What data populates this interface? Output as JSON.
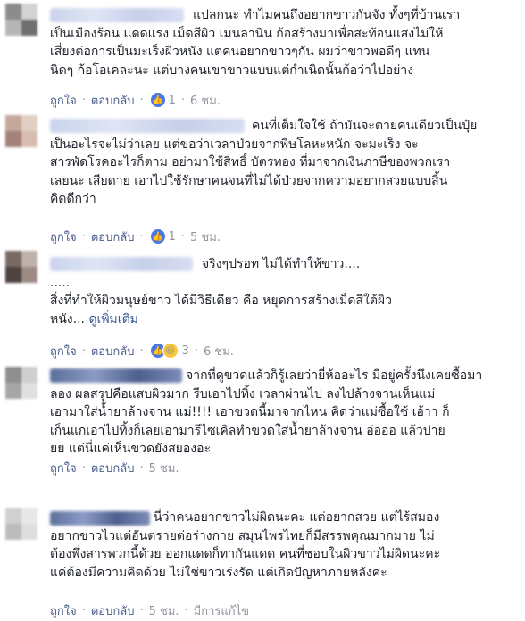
{
  "comments": [
    {
      "first_line": "แปลกนะ ทำไมคนถึงอยากขาวกันจัง ทั้งๆที่บ้านเรา",
      "body": "เป็นเมืองร้อน แดดแรง เม็ดสีผิว เมนลานิน ก้อสร้างมาเพื่อสะท้อนแสงไม่ให้\nเสี่ยงต่อการเป็นมะเร็งผิวหนัง แต่คนอยากขาวๆกัน ผมว่าขาวพอดีๆ แทน\nนิดๆ ก้อโอเคละนะ แต่บางคนเขาขาวแบบแต่กำเนิดนั้นก้อว่าไปอย่าง",
      "like": "ถูกใจ",
      "reply": "ตอบกลับ",
      "reaction_count": "1",
      "time": "6 ชม.",
      "edited": ""
    },
    {
      "first_line": "คนที่เต็มใจใช้ ถ้ามันจะตายคนเดียวเป็นปุ๋ย",
      "body": "เป็นอะไรจะไม่ว่าเลย แต่ขอว่าเวลาป่วยจากพิษโลหะหนัก จะมะเร็ง จะ\nสารพัดโรคอะไรก็ตาม อย่ามาใช้สิทธิ์ บัตรทอง ที่มาจากเงินภาษีของพวกเรา\nเลยนะ เสียดาย เอาไปใช้รักษาคนจนที่ไม่ได้ป่วยจากความอยากสวยแบบสิ้น\nคิดดีกว่า",
      "like": "ถูกใจ",
      "reply": "ตอบกลับ",
      "reaction_count": "1",
      "time": "5 ชม.",
      "edited": ""
    },
    {
      "first_line": "จริงๆปรอท ไม่ได้ทำให้ขาว....",
      "body": ".....\nสิ่งที่ทำให้ผิวมนุษย์ขาว ได้มีวิธีเดียว คือ หยุดการสร้างเม็ดสีใต้ผิว\nหนัง...",
      "see_more": "ดูเพิ่มเติม",
      "like": "ถูกใจ",
      "reply": "ตอบกลับ",
      "reaction_count": "3",
      "time": "6 ชม.",
      "edited": ""
    },
    {
      "first_line": "จากที่ดูขวดแล้วก็รู้เลยว่ายี่ห้ออะไร มีอยู่ครั้งนึงเคยซื้อมา",
      "body": "ลอง ผลสรุปคือแสบผิวมาก รีบเอาไปทิ้ง เวลาผ่านไป ลงไปล้างจานเห็นแม่\nเอามาใส่น้ำยาล้างจาน แม่!!!! เอาขวดนี้มาจากไหน คิดว่าแม่ซื้อใช้ เอ้าา ก็\nเก็นแกเอาไปทิ้งก็เลยเอามารีไซเคิลทำขวดใส่น้ำยาล้างจาน อ่อออ แล้วปาย\nยย แต่นี่แค่เห็นขวดยังสยองอะ",
      "like": "ถูกใจ",
      "reply": "ตอบกลับ",
      "reaction_count": "",
      "time": "5 ชม.",
      "edited": ""
    },
    {
      "first_line": "นี่ว่าคนอยากขาวไม่ผิดนะคะ แต่อยากสวย แต่ไร้สมอง",
      "body": "อยากขาวไวแต่อันตรายต่อร่างกาย สมุนไพรไทยก็มีสรรพคุณมากมาย ไม่\nต้องพึ่งสารพวกนี้ด้วย ออกแดดก็ทากันแดด คนที่ชอบในผิวขาวไม่ผิดนะคะ\nแค่ต้องมีความคิดด้วย ไม่ใช่ขาวเร่งรัด แต่เกิดปัญหาภายหลังค่ะ",
      "like": "ถูกใจ",
      "reply": "ตอบกลับ",
      "reaction_count": "",
      "time": "5 ชม.",
      "edited": "มีการแก้ไข"
    }
  ],
  "icons": {
    "like": "thumbs-up-icon",
    "haha": "laughing-emoji-icon"
  },
  "colors": {
    "link": "#4b5d8c",
    "meta": "#90949c",
    "like_badge": "#4a76e8",
    "haha_badge": "#f7c83e"
  }
}
